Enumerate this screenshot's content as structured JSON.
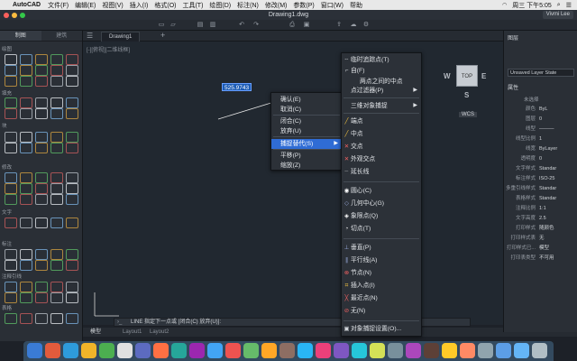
{
  "menubar": {
    "app": "AutoCAD",
    "items": [
      "文件(F)",
      "编辑(E)",
      "视图(V)",
      "插入(I)",
      "格式(O)",
      "工具(T)",
      "绘图(D)",
      "标注(N)",
      "修改(M)",
      "参数(P)",
      "窗口(W)",
      "帮助"
    ],
    "clock": "周三 下午5:05"
  },
  "window": {
    "title": "Drawing1.dwg",
    "user": "Vivmi Lee"
  },
  "left_palette": {
    "tabs": [
      "制图",
      "建筑"
    ],
    "sections": [
      "绘图",
      "填充",
      "块",
      "修改",
      "文字",
      "标注",
      "注释引线",
      "表格"
    ]
  },
  "doc_tab": "Drawing1",
  "viewport_label": "[-][俯视][二维线框]",
  "dim_input": "525.9743",
  "context_menu": {
    "items": [
      {
        "label": "确认(E)"
      },
      {
        "label": "取消(C)"
      },
      {
        "label": "闭合(C)"
      },
      {
        "label": "放弃(U)"
      },
      {
        "label": "捕捉替代(S)",
        "submenu": true
      },
      {
        "label": "平移(P)"
      },
      {
        "label": "缩放(Z)"
      }
    ]
  },
  "snap_menu": {
    "items": [
      {
        "label": "临时追踪点(T)",
        "icon": "temp-track-icon"
      },
      {
        "label": "自(F)",
        "icon": "from-icon"
      },
      {
        "label": "两点之间的中点",
        "icon": ""
      },
      {
        "label": "点过滤器(P)",
        "icon": "",
        "submenu": true
      },
      {
        "label": "三维对象捕捉",
        "icon": "",
        "submenu": true
      },
      {
        "label": "端点",
        "icon": "endpoint-icon"
      },
      {
        "label": "中点",
        "icon": "midpoint-icon"
      },
      {
        "label": "交点",
        "icon": "intersection-icon"
      },
      {
        "label": "外观交点",
        "icon": "apparent-intersection-icon"
      },
      {
        "label": "延长线",
        "icon": "extension-icon"
      },
      {
        "label": "圆心(C)",
        "icon": "center-icon"
      },
      {
        "label": "几何中心(G)",
        "icon": "geometric-center-icon"
      },
      {
        "label": "象限点(Q)",
        "icon": "quadrant-icon"
      },
      {
        "label": "切点(T)",
        "icon": "tangent-icon"
      },
      {
        "label": "垂直(P)",
        "icon": "perpendicular-icon"
      },
      {
        "label": "平行线(A)",
        "icon": "parallel-icon"
      },
      {
        "label": "节点(N)",
        "icon": "node-icon"
      },
      {
        "label": "插入点(I)",
        "icon": "insertion-icon"
      },
      {
        "label": "最近点(N)",
        "icon": "nearest-icon"
      },
      {
        "label": "无(N)",
        "icon": "none-icon"
      },
      {
        "label": "对象捕捉设置(O)...",
        "icon": "osnap-settings-icon"
      }
    ]
  },
  "command_line": "LINE 指定下一点或 [闭合(C) 放弃(U)]:",
  "status_tabs": [
    "模型",
    "Layout1",
    "Layout2"
  ],
  "properties": {
    "title": "图层",
    "layer_state": "Unsaved Layer State",
    "section": "属性",
    "selection": "未选择",
    "rows": [
      {
        "k": "颜色",
        "v": "ByL"
      },
      {
        "k": "图层",
        "v": "0"
      },
      {
        "k": "线型",
        "v": "———"
      },
      {
        "k": "线型比例",
        "v": "1"
      },
      {
        "k": "线宽",
        "v": "ByLayer"
      },
      {
        "k": "透明度",
        "v": "0"
      },
      {
        "k": "文字样式",
        "v": "Standar"
      },
      {
        "k": "标注样式",
        "v": "ISO-25"
      },
      {
        "k": "多重引线样式",
        "v": "Standar"
      },
      {
        "k": "表格样式",
        "v": "Standar"
      },
      {
        "k": "注释比例",
        "v": "1:1"
      },
      {
        "k": "文字高度",
        "v": "2.5"
      },
      {
        "k": "打印样式",
        "v": "随颜色"
      },
      {
        "k": "打印样式表",
        "v": "无"
      },
      {
        "k": "打印样式已...",
        "v": "模型"
      },
      {
        "k": "打印表类型",
        "v": "不可用"
      }
    ]
  },
  "viewcube": {
    "face": "TOP",
    "w": "W",
    "e": "E",
    "s": "S",
    "wcs": "WCS"
  },
  "colors": {
    "accent": "#2f6cd5",
    "canvas": "#212830"
  }
}
